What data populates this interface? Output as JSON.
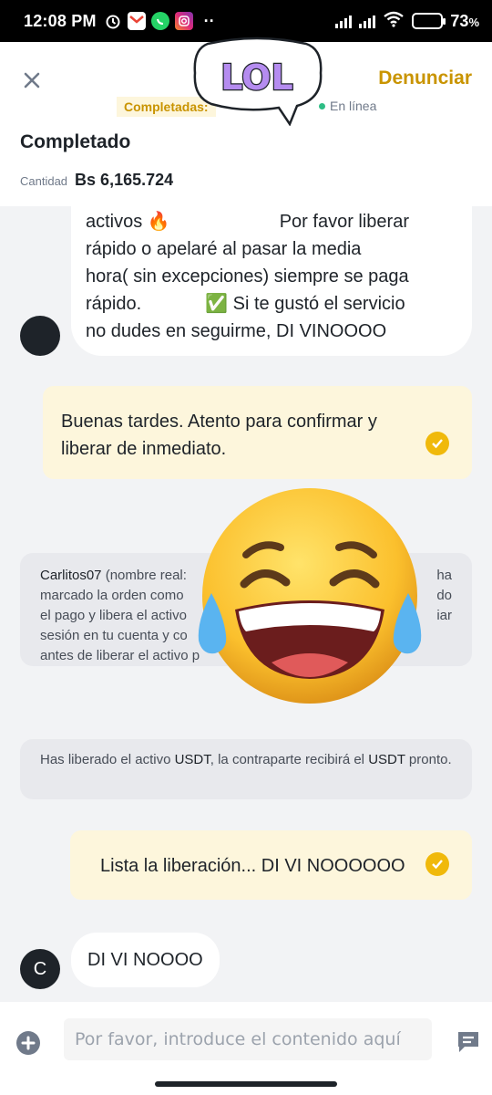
{
  "status_bar": {
    "time": "12:08 PM",
    "more": "··",
    "battery_percent": "73",
    "battery_suffix": "%",
    "battery_level": 0.73
  },
  "header": {
    "close_icon": "close-icon",
    "report_label": "Denunciar",
    "completed_badge": "Completadas:",
    "online_label": "En línea",
    "status_title": "Completado",
    "amount_label": "Cantidad",
    "amount_value": "Bs 6,165.724",
    "sticker_text": "LOL"
  },
  "messages": {
    "first_them": {
      "line1_a": "activos 🔥",
      "line1_b": "Por favor liberar",
      "line2": "rápido o apelaré al pasar la media",
      "line3": "hora( sin excepciones) siempre se paga",
      "line4_a": "rápido.",
      "line4_b": "✅ Si te gustó el servicio",
      "line5": "no dudes en seguirme, DI VINOOOO"
    },
    "me_1": {
      "line1": "Buenas tardes. Atento para confirmar y",
      "line2": "liberar de inmediato."
    },
    "system_1": {
      "name": "Carlitos07",
      "l1_a": "(nombre real:",
      "l1_b": "ha",
      "l2_a": "marcado la orden como",
      "l2_b": "do",
      "l3_a": "el pago y libera el activo",
      "l3_b": "iar",
      "l4_a": "sesión en tu cuenta y co",
      "l5_a": "antes de liberar el activo p"
    },
    "system_2": {
      "part1": "Has liberado el activo",
      "asset1": "USDT",
      "part2": ", la contraparte recibirá el",
      "asset2": "USDT",
      "part3": "pronto."
    },
    "me_2": {
      "text": "Lista la liberación... DI VI NOOOOOO"
    },
    "last_them": {
      "avatar_letter": "C",
      "text": "DI VI NOOOO"
    }
  },
  "input": {
    "placeholder": "Por favor, introduce el contenido aquí"
  },
  "colors": {
    "accent": "#f0b90b",
    "accent_text": "#c99400",
    "online": "#2ebd85",
    "my_bubble": "#fdf6dc",
    "system_bubble": "#e8e9ed"
  }
}
